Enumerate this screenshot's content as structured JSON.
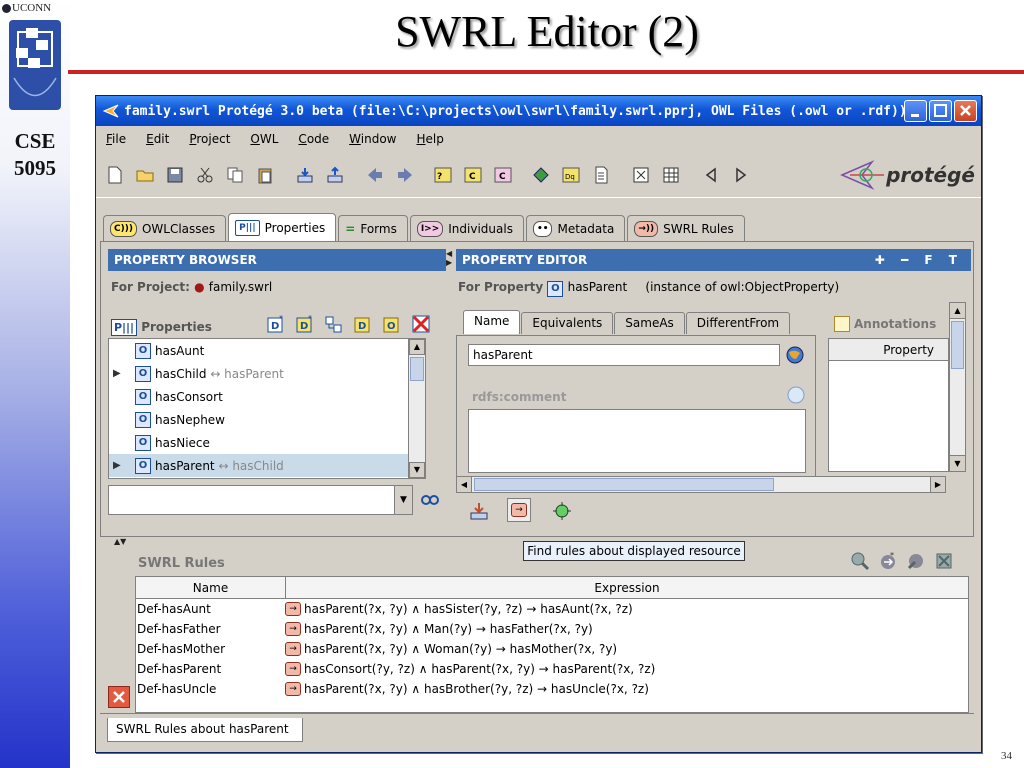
{
  "slide": {
    "logo_text": "UCONN",
    "title": "SWRL Editor (2)",
    "course_line1": "CSE",
    "course_line2": "5095",
    "page_number": "34"
  },
  "window": {
    "title": "family.swrl  Protégé 3.0 beta   (file:\\C:\\projects\\owl\\swrl\\family.swrl.pprj, OWL Files (.owl or .rdf))"
  },
  "menu": [
    "File",
    "Edit",
    "Project",
    "OWL",
    "Code",
    "Window",
    "Help"
  ],
  "toolbar": {
    "brand": "protégé"
  },
  "tabs": [
    {
      "icon": "C)))",
      "label": "OWLClasses"
    },
    {
      "icon": "P|||",
      "label": "Properties"
    },
    {
      "icon": "=",
      "label": "Forms"
    },
    {
      "icon": "I>>",
      "label": "Individuals"
    },
    {
      "icon": "••",
      "label": "Metadata"
    },
    {
      "icon": "→))",
      "label": "SWRL Rules"
    }
  ],
  "property_browser": {
    "header": "PROPERTY BROWSER",
    "for_project_label": "For Project:",
    "project_name": "family.swrl",
    "list_title": "Properties",
    "items": [
      {
        "name": "hasAunt"
      },
      {
        "name": "hasChild",
        "inverse": "↔ hasParent"
      },
      {
        "name": "hasConsort"
      },
      {
        "name": "hasNephew"
      },
      {
        "name": "hasNiece"
      },
      {
        "name": "hasParent",
        "inverse": "↔ hasChild"
      }
    ]
  },
  "property_editor": {
    "header": "PROPERTY EDITOR",
    "for_property_label": "For Property",
    "property_name": "hasParent",
    "instance_of": "(instance of owl:ObjectProperty)",
    "tabs": [
      "Name",
      "Equivalents",
      "SameAs",
      "DifferentFrom"
    ],
    "name_value": "hasParent",
    "comment_label": "rdfs:comment",
    "annotations_label": "Annotations",
    "annotations_column": "Property"
  },
  "tooltip": "Find rules about displayed resource",
  "swrl": {
    "label": "SWRL Rules",
    "columns": [
      "Name",
      "Expression"
    ],
    "rules": [
      {
        "name": "Def-hasAunt",
        "expression": "hasParent(?x, ?y)  ∧  hasSister(?y, ?z)  →  hasAunt(?x, ?z)"
      },
      {
        "name": "Def-hasFather",
        "expression": "hasParent(?x, ?y)  ∧  Man(?y)  →  hasFather(?x, ?y)"
      },
      {
        "name": "Def-hasMother",
        "expression": "hasParent(?x, ?y)  ∧  Woman(?y)  →  hasMother(?x, ?y)"
      },
      {
        "name": "Def-hasParent",
        "expression": "hasConsort(?y, ?z)  ∧  hasParent(?x, ?y)  →  hasParent(?x, ?z)"
      },
      {
        "name": "Def-hasUncle",
        "expression": "hasParent(?x, ?y)  ∧  hasBrother(?y, ?z)  →  hasUncle(?x, ?z)"
      }
    ],
    "bottom_tab": "SWRL Rules about hasParent"
  }
}
